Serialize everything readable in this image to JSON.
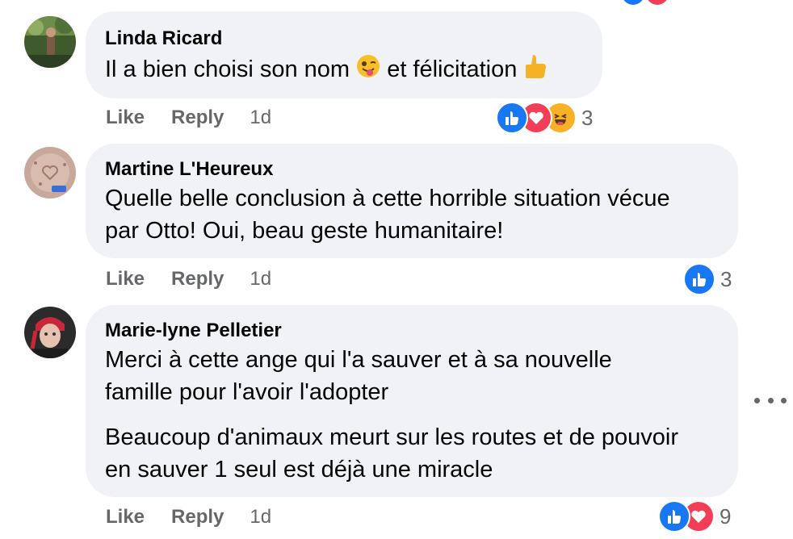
{
  "comments": [
    {
      "author": "Linda Ricard",
      "text_line1": "Il a bien choisi son nom",
      "text_line1b": "et félicitation",
      "inline_emoji_1": "winking-face-with-tongue-icon",
      "inline_emoji_2": "thumbs-up-icon",
      "actions": {
        "like": "Like",
        "reply": "Reply",
        "time": "1d"
      },
      "reactions": {
        "types": [
          "like",
          "love",
          "haha"
        ],
        "count": "3"
      }
    },
    {
      "author": "Martine L'Heureux",
      "lines": [
        "Quelle belle conclusion à cette horrible situation vécue",
        "par Otto! Oui, beau geste humanitaire!"
      ],
      "actions": {
        "like": "Like",
        "reply": "Reply",
        "time": "1d"
      },
      "reactions": {
        "types": [
          "like"
        ],
        "count": "3"
      }
    },
    {
      "author": "Marie-lyne Pelletier",
      "lines": [
        "Merci à cette ange qui l'a sauver et à sa nouvelle",
        "famille pour l'avoir l'adopter"
      ],
      "lines2": [
        "Beaucoup d'animaux meurt sur les routes et de pouvoir",
        "en sauver 1 seul est déjà une miracle"
      ],
      "actions": {
        "like": "Like",
        "reply": "Reply",
        "time": "1d"
      },
      "reactions": {
        "types": [
          "like",
          "love"
        ],
        "count": "9"
      }
    }
  ],
  "colors": {
    "bubble": "#f0f2f5",
    "secondary_text": "#65676b",
    "like_blue": "#1877f2",
    "love_red": "#f33e58",
    "haha_yellow": "#f7b125"
  },
  "more_menu_icon": "more-options-icon"
}
